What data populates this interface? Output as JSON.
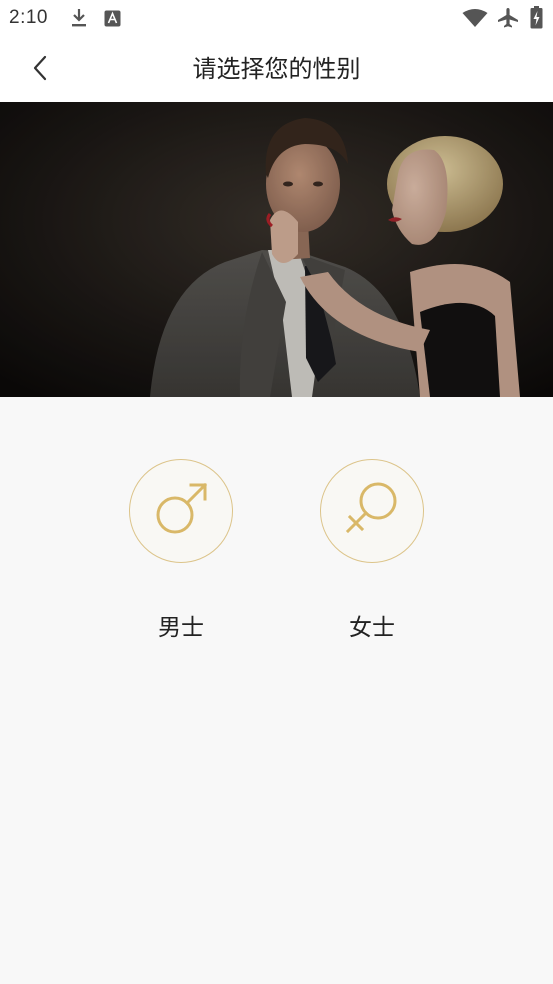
{
  "status_bar": {
    "time": "2:10",
    "icons": [
      "download-icon",
      "keyboard-a-icon",
      "wifi-icon",
      "airplane-icon",
      "battery-icon"
    ]
  },
  "app_bar": {
    "title": "请选择您的性别",
    "back_icon": "chevron-left-icon"
  },
  "hero": {
    "image": "couple-photo"
  },
  "gender_options": [
    {
      "label": "男士",
      "icon": "male-symbol-icon"
    },
    {
      "label": "女士",
      "icon": "female-symbol-icon"
    }
  ],
  "colors": {
    "accent_gold": "#d9b868",
    "circle_border": "#dcc48a",
    "background": "#f8f8f8",
    "app_bar": "#ffffff"
  }
}
